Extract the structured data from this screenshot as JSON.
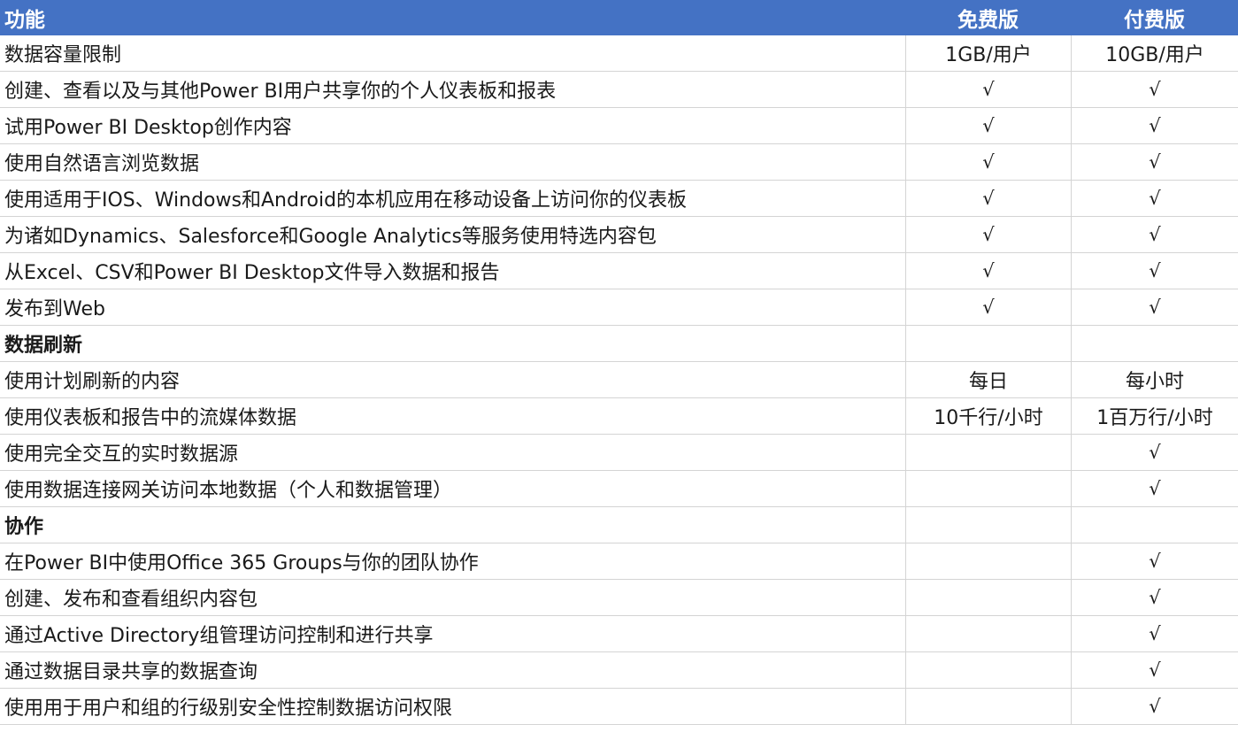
{
  "header": {
    "feature": "功能",
    "free": "免费版",
    "paid": "付费版"
  },
  "rows": [
    {
      "feature": "数据容量限制",
      "free": "1GB/用户",
      "paid": "10GB/用户"
    },
    {
      "feature": "创建、查看以及与其他Power BI用户共享你的个人仪表板和报表",
      "free": "√",
      "paid": "√"
    },
    {
      "feature": "试用Power BI Desktop创作内容",
      "free": "√",
      "paid": "√"
    },
    {
      "feature": "使用自然语言浏览数据",
      "free": "√",
      "paid": "√"
    },
    {
      "feature": "使用适用于IOS、Windows和Android的本机应用在移动设备上访问你的仪表板",
      "free": "√",
      "paid": "√"
    },
    {
      "feature": "为诸如Dynamics、Salesforce和Google Analytics等服务使用特选内容包",
      "free": "√",
      "paid": "√"
    },
    {
      "feature": "从Excel、CSV和Power BI Desktop文件导入数据和报告",
      "free": "√",
      "paid": "√"
    },
    {
      "feature": "发布到Web",
      "free": "√",
      "paid": "√"
    },
    {
      "feature": "数据刷新",
      "free": "",
      "paid": "",
      "section": true
    },
    {
      "feature": "使用计划刷新的内容",
      "free": "每日",
      "paid": "每小时"
    },
    {
      "feature": "使用仪表板和报告中的流媒体数据",
      "free": "10千行/小时",
      "paid": "1百万行/小时"
    },
    {
      "feature": "使用完全交互的实时数据源",
      "free": "",
      "paid": "√"
    },
    {
      "feature": "使用数据连接网关访问本地数据（个人和数据管理）",
      "free": "",
      "paid": "√"
    },
    {
      "feature": "协作",
      "free": "",
      "paid": "",
      "section": true
    },
    {
      "feature": "在Power BI中使用Office 365 Groups与你的团队协作",
      "free": "",
      "paid": "√"
    },
    {
      "feature": "创建、发布和查看组织内容包",
      "free": "",
      "paid": "√"
    },
    {
      "feature": "通过Active Directory组管理访问控制和进行共享",
      "free": "",
      "paid": "√"
    },
    {
      "feature": "通过数据目录共享的数据查询",
      "free": "",
      "paid": "√"
    },
    {
      "feature": "使用用于用户和组的行级别安全性控制数据访问权限",
      "free": "",
      "paid": "√"
    }
  ]
}
